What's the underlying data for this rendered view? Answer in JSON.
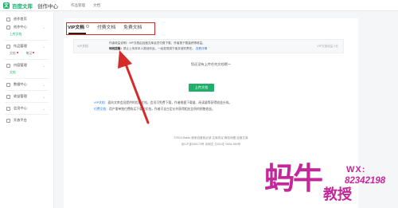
{
  "topbar": {
    "logo_text": "百度文库",
    "logo_sub": "创作中心",
    "nav": [
      "作品管理",
      "文档"
    ]
  },
  "sidebar": {
    "items": [
      {
        "label": "创作首页"
      },
      {
        "label": "创作中心",
        "sub": [
          {
            "label": "上传文档",
            "tone": "green"
          }
        ]
      },
      {
        "label": "作品管理"
      },
      {
        "label": "内容管理",
        "sub": [
          {
            "label": "文档",
            "tone": "normal"
          },
          {
            "label": "笔记",
            "tone": "normal"
          }
        ]
      },
      {
        "label": "数据中心"
      },
      {
        "label": "收益管理"
      },
      {
        "label": "会员中心"
      },
      {
        "label": "开放平台"
      }
    ]
  },
  "main": {
    "tabs": [
      {
        "label": "VIP文档"
      },
      {
        "label": "付费文档"
      },
      {
        "label": "免费文档"
      }
    ],
    "notice": {
      "tag": "VIP文档",
      "line1": "作者收益说明：VIP文档由百度文库会员付费下载，作者按下载量获得收益。",
      "line2_bold": "特别提醒：",
      "line2_text": "禁止上传非本人原创作品，一经发现将下架并追究责任。",
      "line2_link": "查看详情",
      "right": "VIP文档收益 0元"
    },
    "empty_text": "您还没有上传任何文档哦～",
    "upload_button": "上传文档",
    "desc1_hl": "VIP文档：",
    "desc1": "面向文库会员提供的优质文档，会员可免费下载，作者根据下载量、阅读量等获得收益分成。",
    "desc2_hl": "付费文档：",
    "desc2": "用户需单独付费购买下载的文档，作者可自主定价并获得相应比例的销售收益。",
    "footer1": "©2024 Baidu 使用百度前必读 文库协议 网站地图 百度文库",
    "footer2": "京ICP证030173号 京网文【2013】0934-983号"
  },
  "watermark": {
    "big": "蚂牛",
    "wx": "WX:",
    "number": "82342198",
    "sub": "教授"
  }
}
